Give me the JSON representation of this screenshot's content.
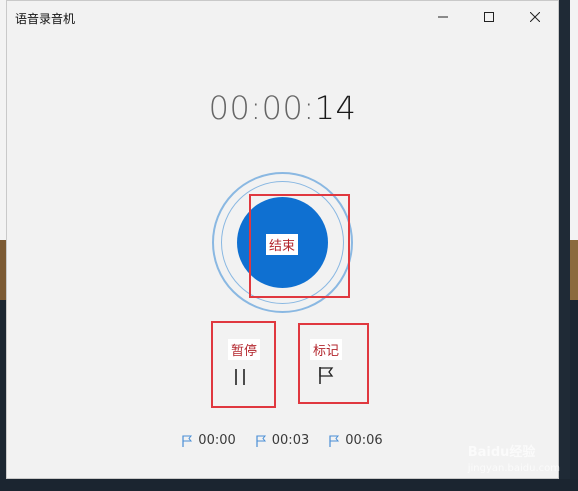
{
  "window": {
    "title": "语音录音机"
  },
  "timer": {
    "dim": "00:00:",
    "bright": "14"
  },
  "controls": {
    "stop_label": "结束",
    "pause_label": "暂停",
    "mark_label": "标记"
  },
  "markers": [
    {
      "time": "00:00"
    },
    {
      "time": "00:03"
    },
    {
      "time": "00:06"
    }
  ],
  "watermark": {
    "text": "Baidu经验",
    "sub": "jingyan.baidu.com"
  },
  "colors": {
    "accent": "#0f70d1",
    "ring": "#8ab8e2",
    "highlight": "#e0383f",
    "label_text": "#b3262d"
  },
  "icons": [
    "minimize-icon",
    "maximize-icon",
    "close-icon",
    "pause-icon",
    "flag-icon",
    "marker-flag-icon"
  ]
}
